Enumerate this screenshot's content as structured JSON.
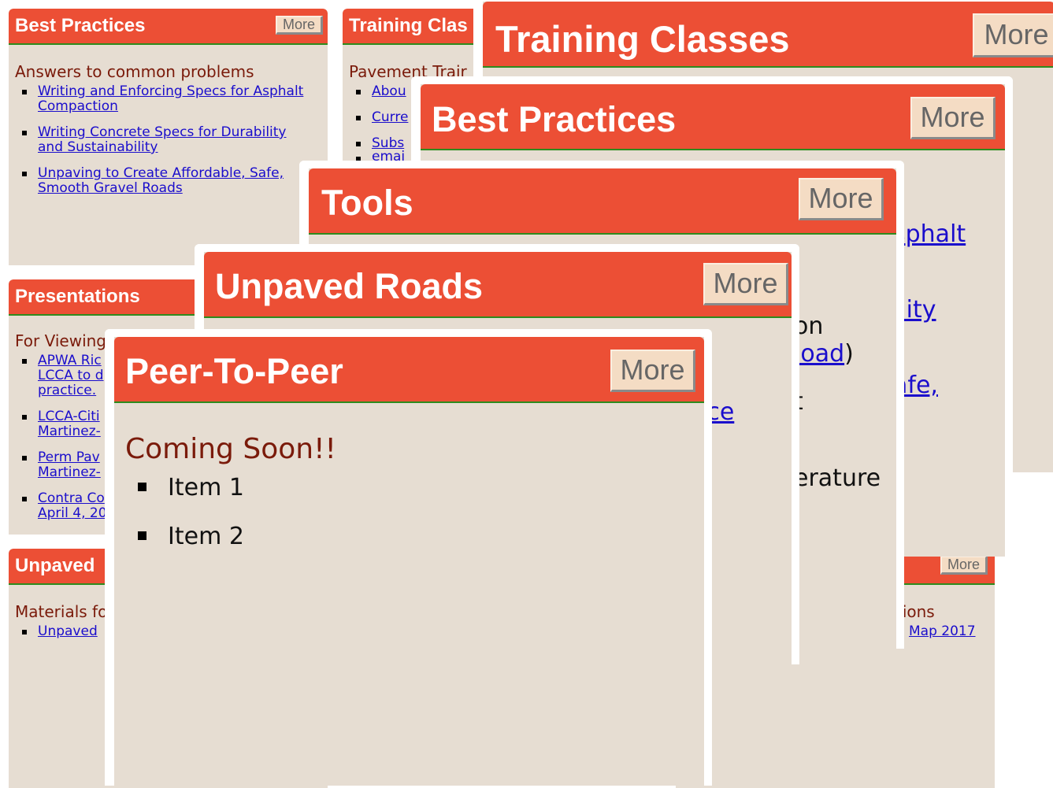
{
  "panels": {
    "best_practices_small": {
      "title": "Best Practices",
      "more": "More",
      "subtitle": "Answers to common problems",
      "links": [
        [
          "Writing and Enforcing Specs for Asphalt",
          "Compaction"
        ],
        [
          "Writing Concrete Specs for Durability",
          "and Sustainability"
        ],
        [
          "Unpaving to Create Affordable, Safe,",
          "Smooth Gravel Roads"
        ]
      ]
    },
    "training_classes_small": {
      "title": "Training Clas",
      "subtitle": "Pavement Trair",
      "links": [
        "Abou",
        "Curre",
        "Subs",
        "emai"
      ]
    },
    "presentations_small": {
      "title": "Presentations",
      "subtitle": "For Viewing",
      "links": [
        [
          "APWA Ric",
          "LCCA to d",
          "practice."
        ],
        [
          "LCCA-Citi",
          "Martinez-"
        ],
        [
          "Perm Pav",
          "Martinez-"
        ],
        [
          "Contra Co",
          "April 4, 20"
        ]
      ]
    },
    "unpaved_small": {
      "title": "Unpaved",
      "subtitle": "Materials fo",
      "links": [
        "Unpaved"
      ]
    },
    "right_small": {
      "more": "More",
      "subtitle": "tions",
      "link": "Map 2017"
    },
    "training_classes": {
      "title": "Training Classes",
      "more": "More"
    },
    "best_practices": {
      "title": "Best Practices",
      "more": "More",
      "fragments": [
        "sphalt",
        "ility",
        "afe,"
      ]
    },
    "tools": {
      "title": "Tools",
      "more": "More",
      "fragments": [
        "on",
        "load",
        ")",
        "t",
        "erature"
      ]
    },
    "unpaved_roads": {
      "title": "Unpaved Roads",
      "more": "More",
      "fragments": [
        "ice"
      ]
    },
    "peer_to_peer": {
      "title": "Peer-To-Peer",
      "more": "More",
      "subtitle": "Coming Soon!!",
      "items": [
        "Item 1",
        "Item 2"
      ]
    }
  }
}
